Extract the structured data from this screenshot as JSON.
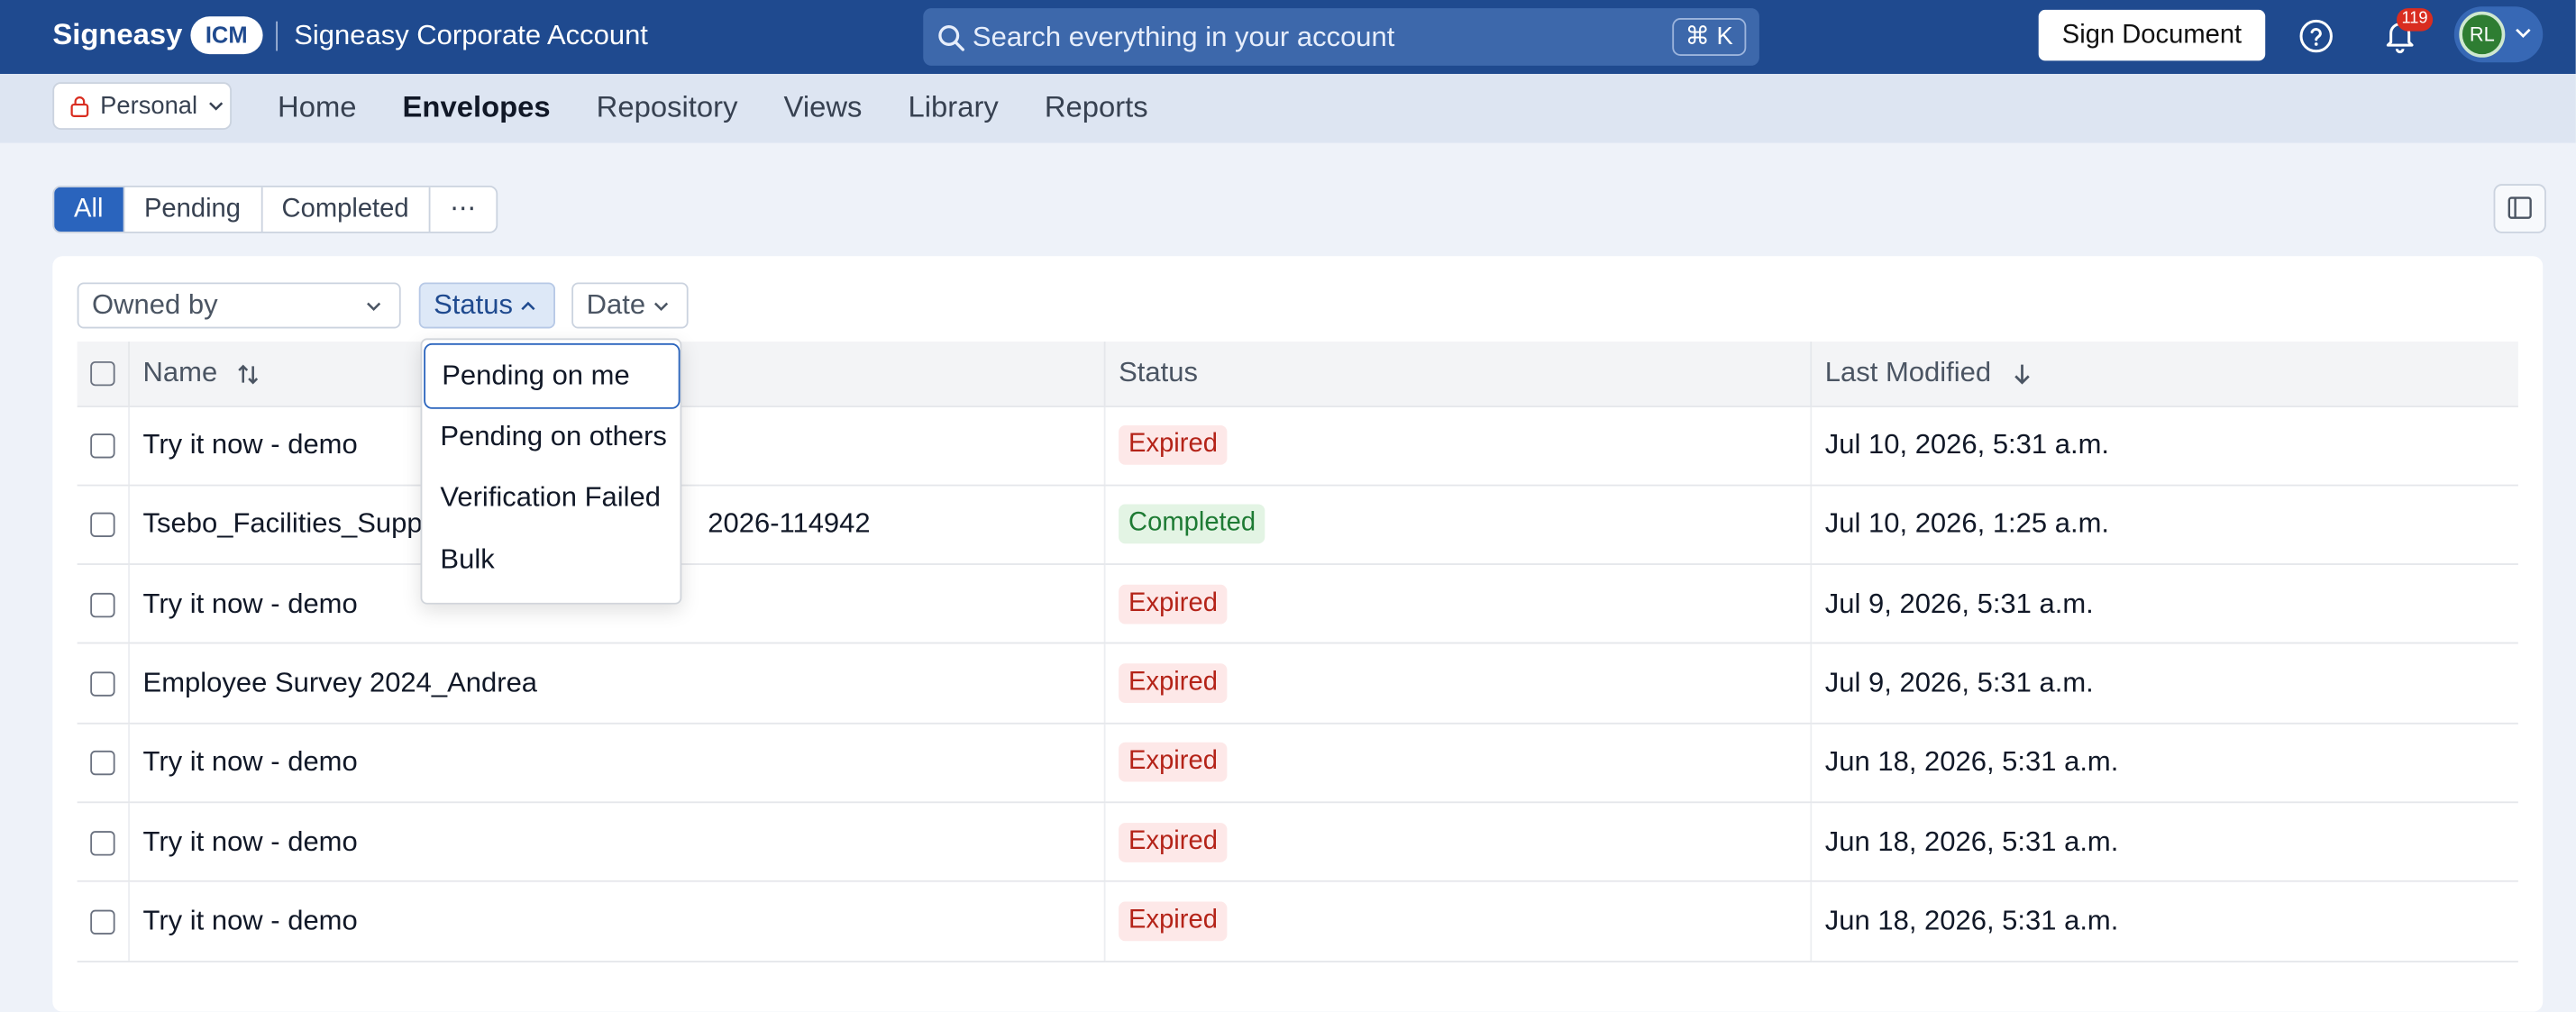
{
  "header": {
    "brand": "Signeasy",
    "brand_badge": "ICM",
    "account_name": "Signeasy Corporate Account",
    "search_placeholder": "Search everything in your account",
    "search_shortcut": "⌘ K",
    "sign_button": "Sign Document",
    "notification_count": "119",
    "avatar_initials": "RL"
  },
  "subnav": {
    "space_selector": "Personal",
    "links": [
      "Home",
      "Envelopes",
      "Repository",
      "Views",
      "Library",
      "Reports"
    ],
    "active_link": "Envelopes"
  },
  "tabs": {
    "items": [
      "All",
      "Pending",
      "Completed",
      "⋯"
    ],
    "active": "All"
  },
  "filters": {
    "owned_by": "Owned by",
    "status": "Status",
    "date": "Date"
  },
  "status_dropdown": {
    "options": [
      "Pending on me",
      "Pending on others",
      "Verification Failed",
      "Bulk"
    ],
    "focused": "Pending on me"
  },
  "table": {
    "columns": [
      "Name",
      "Status",
      "Last Modified"
    ],
    "rows": [
      {
        "name": "Try it now - demo",
        "status": "Expired",
        "modified": "Jul 10, 2026, 5:31 a.m."
      },
      {
        "name": "Tsebo_Facilities_Suppl",
        "name_tail": "2026-114942",
        "status": "Completed",
        "modified": "Jul 10, 2026, 1:25 a.m."
      },
      {
        "name": "Try it now - demo",
        "status": "Expired",
        "modified": "Jul 9, 2026, 5:31 a.m."
      },
      {
        "name": "Employee Survey 2024_Andrea",
        "status": "Expired",
        "modified": "Jul 9, 2026, 5:31 a.m."
      },
      {
        "name": "Try it now - demo",
        "status": "Expired",
        "modified": "Jun 18, 2026, 5:31 a.m."
      },
      {
        "name": "Try it now - demo",
        "status": "Expired",
        "modified": "Jun 18, 2026, 5:31 a.m."
      },
      {
        "name": "Try it now - demo",
        "status": "Expired",
        "modified": "Jun 18, 2026, 5:31 a.m."
      }
    ]
  },
  "colors": {
    "header_bg": "#1f4a8f",
    "accent": "#2a64bd",
    "expired_text": "#b42318",
    "completed_text": "#1e7b34"
  }
}
